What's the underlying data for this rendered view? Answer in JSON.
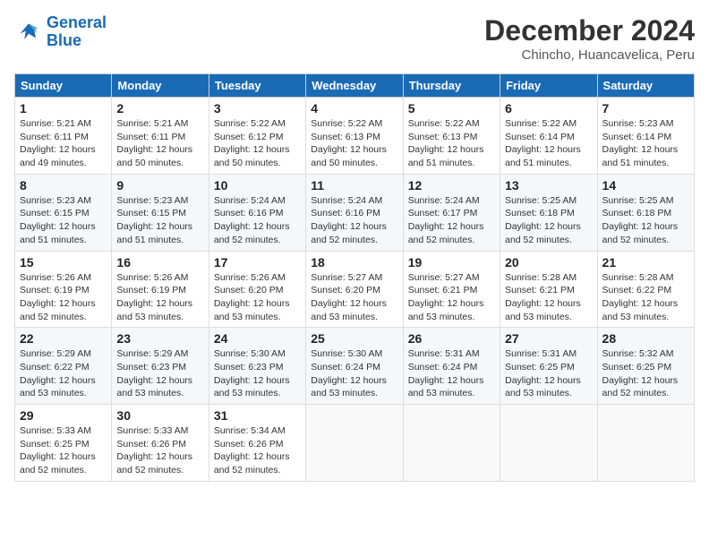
{
  "logo": {
    "line1": "General",
    "line2": "Blue"
  },
  "title": "December 2024",
  "subtitle": "Chincho, Huancavelica, Peru",
  "weekdays": [
    "Sunday",
    "Monday",
    "Tuesday",
    "Wednesday",
    "Thursday",
    "Friday",
    "Saturday"
  ],
  "weeks": [
    [
      {
        "day": "1",
        "info": "Sunrise: 5:21 AM\nSunset: 6:11 PM\nDaylight: 12 hours\nand 49 minutes."
      },
      {
        "day": "2",
        "info": "Sunrise: 5:21 AM\nSunset: 6:11 PM\nDaylight: 12 hours\nand 50 minutes."
      },
      {
        "day": "3",
        "info": "Sunrise: 5:22 AM\nSunset: 6:12 PM\nDaylight: 12 hours\nand 50 minutes."
      },
      {
        "day": "4",
        "info": "Sunrise: 5:22 AM\nSunset: 6:13 PM\nDaylight: 12 hours\nand 50 minutes."
      },
      {
        "day": "5",
        "info": "Sunrise: 5:22 AM\nSunset: 6:13 PM\nDaylight: 12 hours\nand 51 minutes."
      },
      {
        "day": "6",
        "info": "Sunrise: 5:22 AM\nSunset: 6:14 PM\nDaylight: 12 hours\nand 51 minutes."
      },
      {
        "day": "7",
        "info": "Sunrise: 5:23 AM\nSunset: 6:14 PM\nDaylight: 12 hours\nand 51 minutes."
      }
    ],
    [
      {
        "day": "8",
        "info": "Sunrise: 5:23 AM\nSunset: 6:15 PM\nDaylight: 12 hours\nand 51 minutes."
      },
      {
        "day": "9",
        "info": "Sunrise: 5:23 AM\nSunset: 6:15 PM\nDaylight: 12 hours\nand 51 minutes."
      },
      {
        "day": "10",
        "info": "Sunrise: 5:24 AM\nSunset: 6:16 PM\nDaylight: 12 hours\nand 52 minutes."
      },
      {
        "day": "11",
        "info": "Sunrise: 5:24 AM\nSunset: 6:16 PM\nDaylight: 12 hours\nand 52 minutes."
      },
      {
        "day": "12",
        "info": "Sunrise: 5:24 AM\nSunset: 6:17 PM\nDaylight: 12 hours\nand 52 minutes."
      },
      {
        "day": "13",
        "info": "Sunrise: 5:25 AM\nSunset: 6:18 PM\nDaylight: 12 hours\nand 52 minutes."
      },
      {
        "day": "14",
        "info": "Sunrise: 5:25 AM\nSunset: 6:18 PM\nDaylight: 12 hours\nand 52 minutes."
      }
    ],
    [
      {
        "day": "15",
        "info": "Sunrise: 5:26 AM\nSunset: 6:19 PM\nDaylight: 12 hours\nand 52 minutes."
      },
      {
        "day": "16",
        "info": "Sunrise: 5:26 AM\nSunset: 6:19 PM\nDaylight: 12 hours\nand 53 minutes."
      },
      {
        "day": "17",
        "info": "Sunrise: 5:26 AM\nSunset: 6:20 PM\nDaylight: 12 hours\nand 53 minutes."
      },
      {
        "day": "18",
        "info": "Sunrise: 5:27 AM\nSunset: 6:20 PM\nDaylight: 12 hours\nand 53 minutes."
      },
      {
        "day": "19",
        "info": "Sunrise: 5:27 AM\nSunset: 6:21 PM\nDaylight: 12 hours\nand 53 minutes."
      },
      {
        "day": "20",
        "info": "Sunrise: 5:28 AM\nSunset: 6:21 PM\nDaylight: 12 hours\nand 53 minutes."
      },
      {
        "day": "21",
        "info": "Sunrise: 5:28 AM\nSunset: 6:22 PM\nDaylight: 12 hours\nand 53 minutes."
      }
    ],
    [
      {
        "day": "22",
        "info": "Sunrise: 5:29 AM\nSunset: 6:22 PM\nDaylight: 12 hours\nand 53 minutes."
      },
      {
        "day": "23",
        "info": "Sunrise: 5:29 AM\nSunset: 6:23 PM\nDaylight: 12 hours\nand 53 minutes."
      },
      {
        "day": "24",
        "info": "Sunrise: 5:30 AM\nSunset: 6:23 PM\nDaylight: 12 hours\nand 53 minutes."
      },
      {
        "day": "25",
        "info": "Sunrise: 5:30 AM\nSunset: 6:24 PM\nDaylight: 12 hours\nand 53 minutes."
      },
      {
        "day": "26",
        "info": "Sunrise: 5:31 AM\nSunset: 6:24 PM\nDaylight: 12 hours\nand 53 minutes."
      },
      {
        "day": "27",
        "info": "Sunrise: 5:31 AM\nSunset: 6:25 PM\nDaylight: 12 hours\nand 53 minutes."
      },
      {
        "day": "28",
        "info": "Sunrise: 5:32 AM\nSunset: 6:25 PM\nDaylight: 12 hours\nand 52 minutes."
      }
    ],
    [
      {
        "day": "29",
        "info": "Sunrise: 5:33 AM\nSunset: 6:25 PM\nDaylight: 12 hours\nand 52 minutes."
      },
      {
        "day": "30",
        "info": "Sunrise: 5:33 AM\nSunset: 6:26 PM\nDaylight: 12 hours\nand 52 minutes."
      },
      {
        "day": "31",
        "info": "Sunrise: 5:34 AM\nSunset: 6:26 PM\nDaylight: 12 hours\nand 52 minutes."
      },
      null,
      null,
      null,
      null
    ]
  ]
}
